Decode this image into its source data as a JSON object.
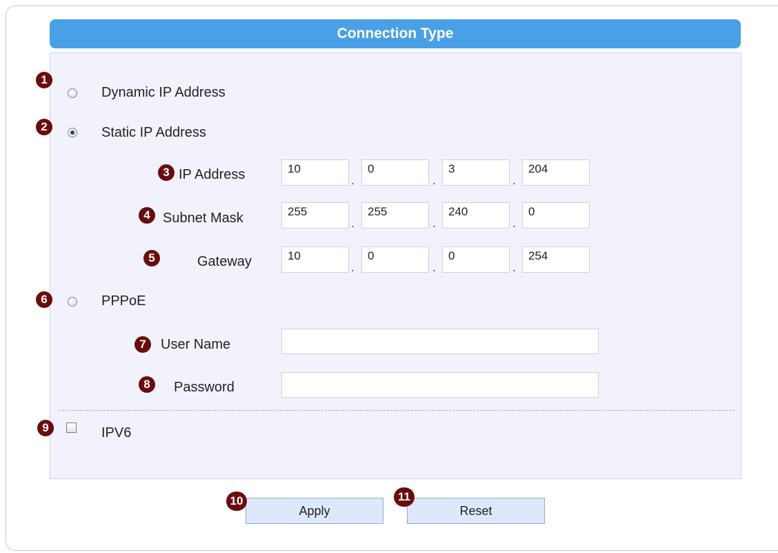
{
  "header": {
    "title": "Connection Type"
  },
  "badges": [
    "1",
    "2",
    "3",
    "4",
    "5",
    "6",
    "7",
    "8",
    "9",
    "10",
    "11"
  ],
  "options": {
    "dynamic": {
      "label": "Dynamic IP Address",
      "selected": false
    },
    "static": {
      "label": "Static IP Address",
      "selected": true
    },
    "pppoe": {
      "label": "PPPoE",
      "selected": false
    },
    "ipv6": {
      "label": "IPV6",
      "checked": false
    }
  },
  "static_fields": {
    "ip_address": {
      "label": "IP Address",
      "octets": [
        "10",
        "0",
        "3",
        "204"
      ]
    },
    "subnet_mask": {
      "label": "Subnet Mask",
      "octets": [
        "255",
        "255",
        "240",
        "0"
      ]
    },
    "gateway": {
      "label": "Gateway",
      "octets": [
        "10",
        "0",
        "0",
        "254"
      ]
    },
    "separator": "."
  },
  "pppoe_fields": {
    "user_name": {
      "label": "User Name",
      "value": ""
    },
    "password": {
      "label": "Password",
      "value": ""
    }
  },
  "buttons": {
    "apply": "Apply",
    "reset": "Reset"
  },
  "colors": {
    "header": "#4aa0e6",
    "badge": "#6b0c0c",
    "panel": "#f2f2fc",
    "button": "#dde9fb"
  }
}
